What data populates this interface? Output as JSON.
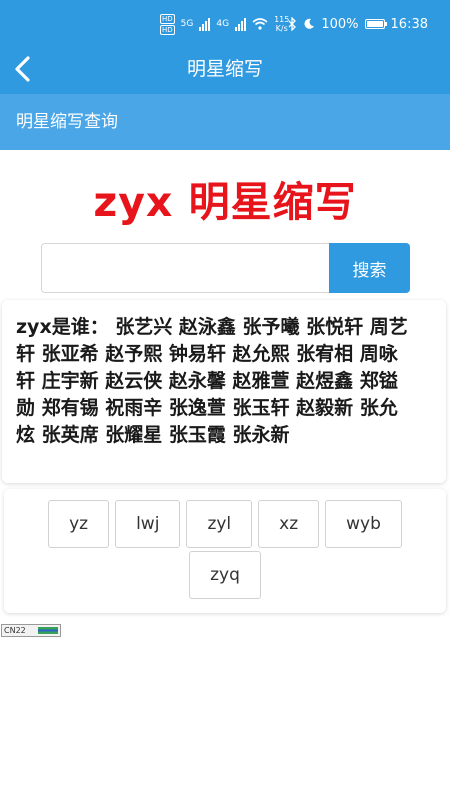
{
  "status_bar": {
    "hd1": "HD",
    "hd2": "HD",
    "net1": "5G",
    "net2": "4G",
    "speed_value": "115",
    "speed_unit": "K/s",
    "battery": "100%",
    "time": "16:38"
  },
  "app_bar": {
    "title": "明星缩写"
  },
  "sub_bar": {
    "title": "明星缩写查询"
  },
  "hero": {
    "title": "zyx 明星缩写"
  },
  "search": {
    "value": "",
    "placeholder": "",
    "button_label": "搜索"
  },
  "result": {
    "text": "zyx是谁： 张艺兴 赵泳鑫 张予曦 张悦轩 周艺轩 张亚希 赵予熙 钟易轩 赵允熙 张宥相 周咏轩 庄宇新 赵云侠 赵永馨 赵雅萱 赵煜鑫 郑镒勋 郑有锡 祝雨辛 张逸萱 张玉轩 赵毅新 张允炫 张英席 张耀星 张玉霞 张永新"
  },
  "related_tags": [
    "yz",
    "lwj",
    "zyl",
    "xz",
    "wyb",
    "zyq"
  ],
  "footer_badge": {
    "text": "CN22"
  },
  "colors": {
    "primary": "#2f9ae0",
    "secondary": "#4aa6e6",
    "accent": "#e8141c"
  }
}
